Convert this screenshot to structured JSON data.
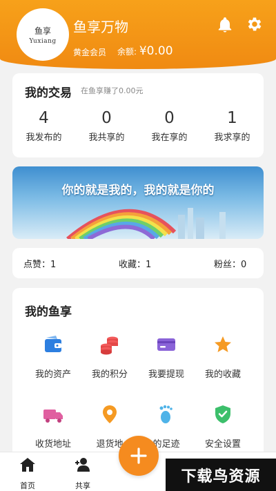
{
  "header": {
    "avatar_line1": "鱼享",
    "avatar_line2": "Yuxiang",
    "username": "鱼享万物",
    "member_level": "黄金会员",
    "balance_label": "余额: ",
    "balance_value": "¥0.00"
  },
  "trade": {
    "title": "我的交易",
    "subtitle": "在鱼享赚了0.00元",
    "stats": [
      {
        "num": "4",
        "label": "我发布的"
      },
      {
        "num": "0",
        "label": "我共享的"
      },
      {
        "num": "0",
        "label": "我在享的"
      },
      {
        "num": "1",
        "label": "我求享的"
      }
    ]
  },
  "banner": {
    "slogan": "你的就是我的，我的就是你的"
  },
  "social": {
    "likes": "点赞：1",
    "favorites": "收藏：1",
    "fans": "粉丝：0"
  },
  "menu": {
    "title": "我的鱼享",
    "items": [
      {
        "label": "我的资产",
        "icon": "wallet-icon"
      },
      {
        "label": "我的积分",
        "icon": "coins-icon"
      },
      {
        "label": "我要提现",
        "icon": "card-icon"
      },
      {
        "label": "我的收藏",
        "icon": "star-icon"
      },
      {
        "label": "收货地址",
        "icon": "truck-icon"
      },
      {
        "label": "退货地",
        "icon": "location-icon"
      },
      {
        "label": "的足迹",
        "icon": "footprint-icon"
      },
      {
        "label": "安全设置",
        "icon": "shield-icon"
      }
    ]
  },
  "tabbar": {
    "home": "首页",
    "share": "共享"
  },
  "watermark": "下载鸟资源",
  "colors": {
    "accent": "#f5901a",
    "fab": "#f58b1f"
  }
}
